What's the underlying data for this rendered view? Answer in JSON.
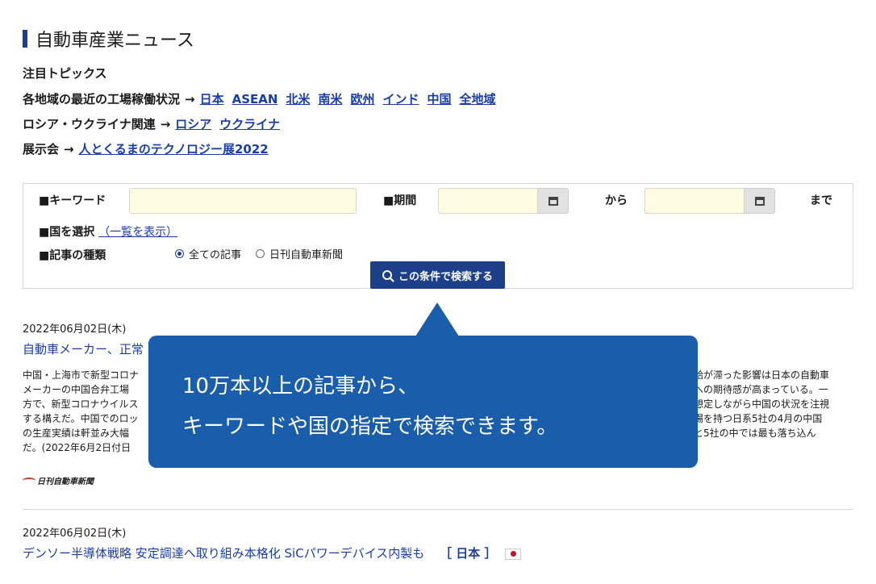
{
  "page": {
    "title": "自動車産業ニュース",
    "topics_heading": "注目トピックス",
    "topic_rows": [
      {
        "prefix": "各地域の最近の工場稼働状況",
        "arrow": "→",
        "links": [
          "日本",
          "ASEAN",
          "北米",
          "南米",
          "欧州",
          "インド",
          "中国",
          "全地域"
        ]
      },
      {
        "prefix": "ロシア・ウクライナ関連",
        "arrow": "→",
        "links": [
          "ロシア",
          "ウクライナ"
        ]
      },
      {
        "prefix": "展示会",
        "arrow": "→",
        "links": [
          "人とくるまのテクノロジー展2022"
        ]
      }
    ]
  },
  "search": {
    "keyword_label": "■キーワード",
    "keyword_value": "",
    "period_label": "■期間",
    "from_label": "から",
    "to_label": "まで",
    "country_label": "■国を選択",
    "country_link": "（一覧を表示）",
    "type_label": "■記事の種類",
    "type_options": [
      "全ての記事",
      "日刊自動車新聞"
    ],
    "selected_type": "全ての記事",
    "button_label": "この条件で検索する"
  },
  "articles": [
    {
      "date": "2022年06月02日(木)",
      "headline_visible": "自動車メーカー、正常",
      "body_left": [
        "中国・上海市で新型コロナ",
        "メーカーの中国合弁工場",
        "方で、新型コロナウイルス",
        "する構えだ。中国でのロッ",
        "の生産実績は軒並み大幅",
        "だ。(2022年6月2日付日"
      ],
      "body_right": [
        "給が滞った影響は日本の自動車",
        "への期待感が高まっている。一",
        "想定しながら中国の状況を注視",
        "場を持つ日系5社の4月の中国",
        "と5社の中では最も落ち込ん",
        ""
      ],
      "source": "日刊自動車新聞"
    },
    {
      "date": "2022年06月02日(木)",
      "headline": "デンソー半導体戦略 安定調達へ取り組み本格化 SiCパワーデバイス内製も",
      "region": "［ 日本 ］"
    }
  ],
  "tooltip": {
    "line1": "10万本以上の記事から、",
    "line2": "キーワードや国の指定で検索できます。"
  }
}
